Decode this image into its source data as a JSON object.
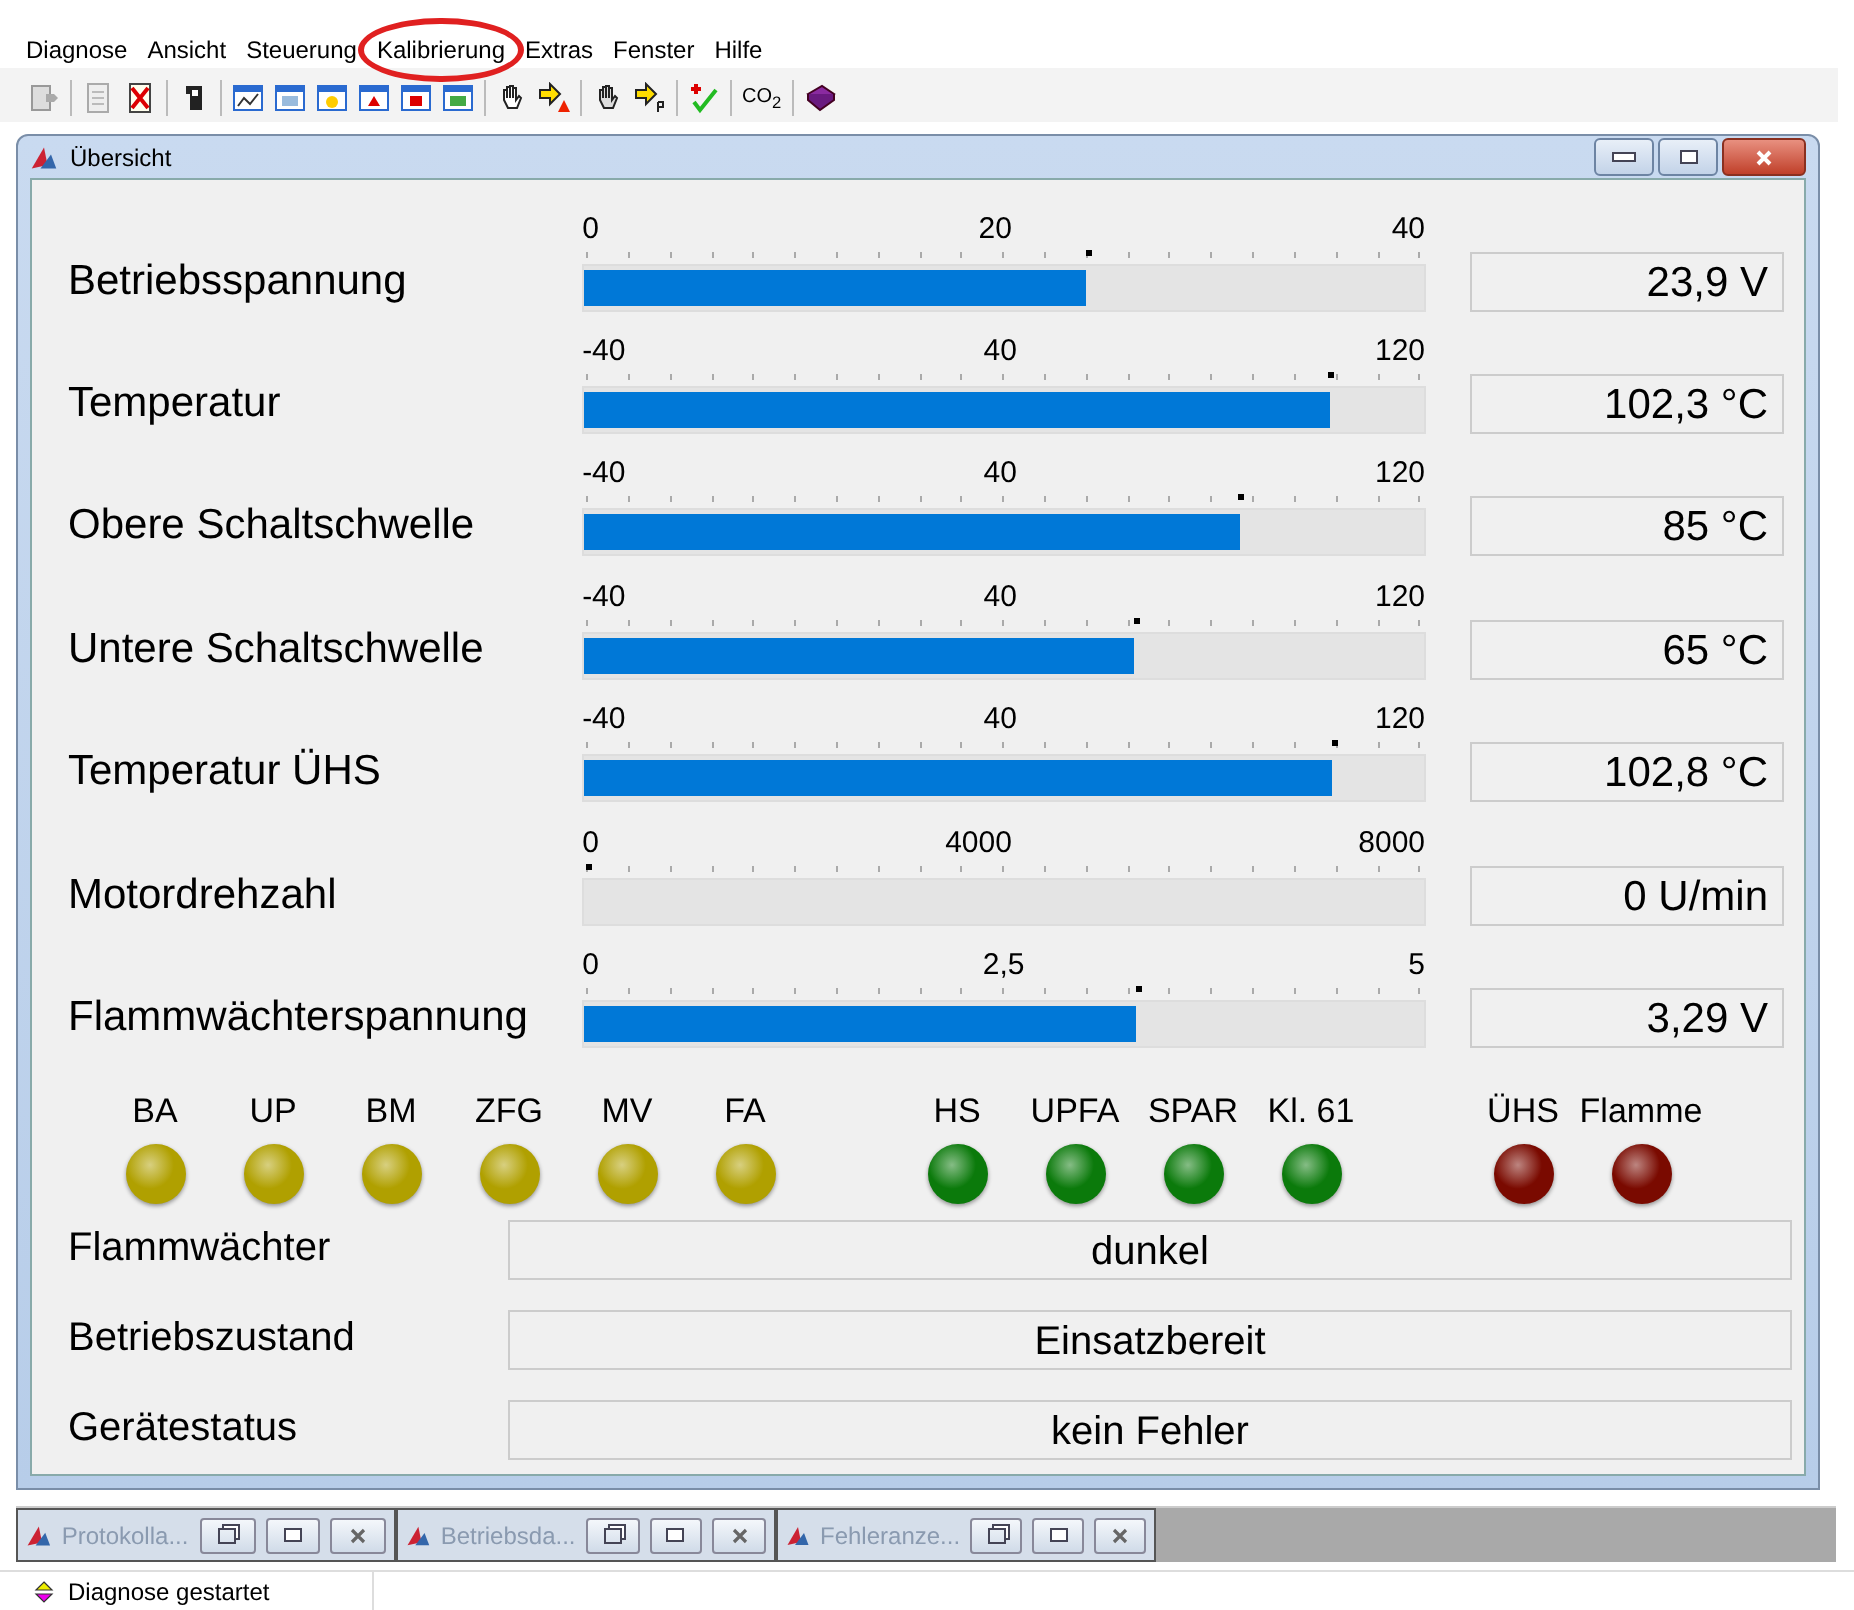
{
  "menu": [
    {
      "label": "Diagnose",
      "highlighted": false
    },
    {
      "label": "Ansicht",
      "highlighted": false
    },
    {
      "label": "Steuerung",
      "highlighted": false
    },
    {
      "label": "Kalibrierung",
      "highlighted": true
    },
    {
      "label": "Extras",
      "highlighted": false
    },
    {
      "label": "Fenster",
      "highlighted": false
    },
    {
      "label": "Hilfe",
      "highlighted": false
    }
  ],
  "toolbar": {
    "co2_label": "CO$_{2}$"
  },
  "window": {
    "title": "Übersicht"
  },
  "gauges": [
    {
      "name": "Betriebsspannung",
      "scale": [
        "0",
        "20",
        "40"
      ],
      "level": 0.5975,
      "reading": "23,9 V"
    },
    {
      "name": "Temperatur",
      "scale": [
        "-40",
        "40",
        "120"
      ],
      "level": 0.889,
      "reading": "102,3 °C"
    },
    {
      "name": "Obere  Schaltschwelle",
      "scale": [
        "-40",
        "40",
        "120"
      ],
      "level": 0.781,
      "reading": "85 °C"
    },
    {
      "name": "Untere Schaltschwelle",
      "scale": [
        "-40",
        "40",
        "120"
      ],
      "level": 0.656,
      "reading": "65 °C"
    },
    {
      "name": "Temperatur ÜHS",
      "scale": [
        "-40",
        "40",
        "120"
      ],
      "level": 0.8925,
      "reading": "102,8 °C"
    },
    {
      "name": "Motordrehzahl",
      "scale": [
        "0",
        "4000",
        "8000"
      ],
      "level": 0,
      "reading": "0 U/min"
    },
    {
      "name": "Flammwächterspannung",
      "scale": [
        "0",
        "2,5",
        "5"
      ],
      "level": 0.658,
      "reading": "3,29 V"
    }
  ],
  "lamp_groups": [
    [
      {
        "label": "BA",
        "color": "#b0a000"
      },
      {
        "label": "UP",
        "color": "#b0a000"
      },
      {
        "label": "BM",
        "color": "#b0a000"
      },
      {
        "label": "ZFG",
        "color": "#b0a000"
      },
      {
        "label": "MV",
        "color": "#b0a000"
      },
      {
        "label": "FA",
        "color": "#b0a000"
      }
    ],
    [
      {
        "label": "HS",
        "color": "#0b7a0b"
      },
      {
        "label": "UPFA",
        "color": "#0b7a0b"
      },
      {
        "label": "SPAR",
        "color": "#0b7a0b"
      },
      {
        "label": "Kl. 61",
        "color": "#0b7a0b"
      }
    ],
    [
      {
        "label": "ÜHS",
        "color": "#7a0a00"
      },
      {
        "label": "Flamme",
        "color": "#7a0a00"
      }
    ]
  ],
  "status_fields": [
    {
      "label": "Flammwächter",
      "value": "dunkel"
    },
    {
      "label": "Betriebszustand",
      "value": "Einsatzbereit"
    },
    {
      "label": "Gerätestatus",
      "value": "kein Fehler"
    }
  ],
  "minimized_windows": [
    {
      "title": "Protokolla..."
    },
    {
      "title": "Betriebsda..."
    },
    {
      "title": "Fehleranze..."
    }
  ],
  "status_bar": {
    "message": "Diagnose gestartet"
  }
}
